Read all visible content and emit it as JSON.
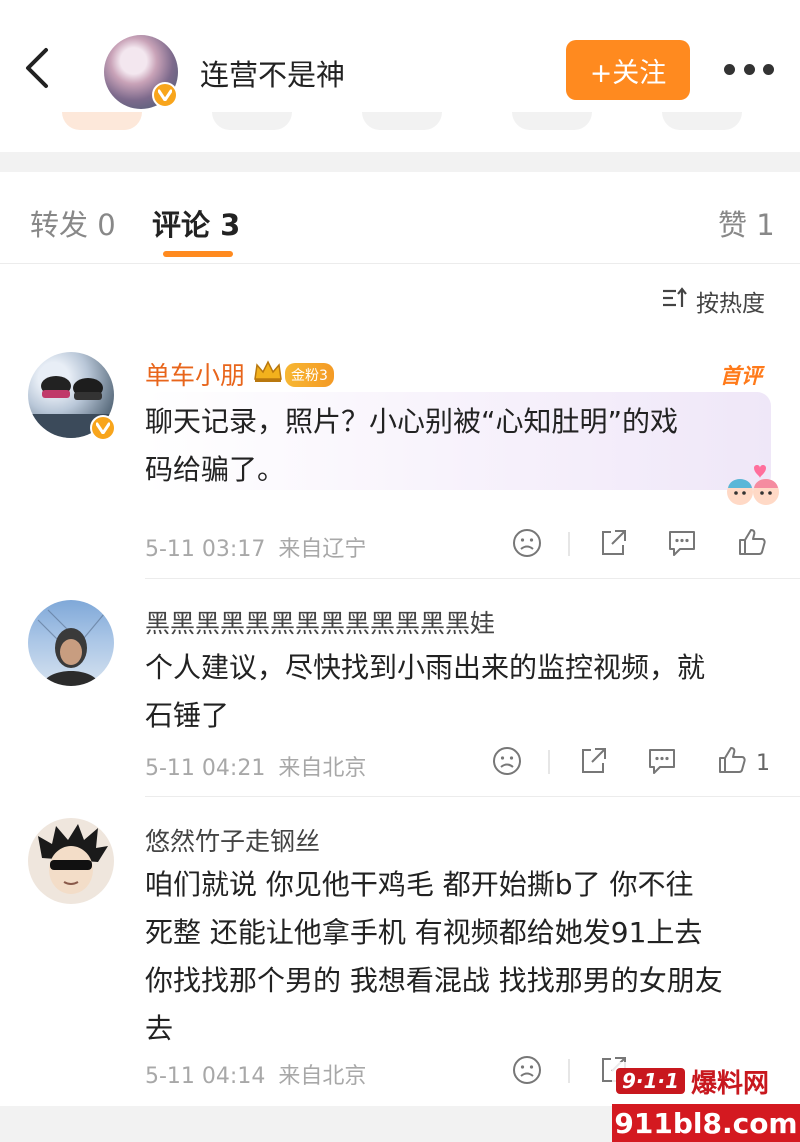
{
  "header": {
    "title": "连营不是神",
    "follow_label": "+关注"
  },
  "tabs": [
    {
      "label": "转发 0"
    },
    {
      "label": "评论 3"
    },
    {
      "label": "赞 1"
    }
  ],
  "sort_label": "按热度",
  "comments": [
    {
      "username": "单车小朋",
      "fans_badge": "金粉3",
      "top_badge": "首评",
      "text_line1": "聊天记录，照片？小心别被“心知肚明”的戏",
      "text_line2": "码给骗了。",
      "timestamp": "5-11 03:17",
      "location": "来自辽宁",
      "like_count": ""
    },
    {
      "username": "黑黑黑黑黑黑黑黑黑黑黑黑黑娃",
      "text_line1": "个人建议，尽快找到小雨出来的监控视频，就",
      "text_line2": "石锤了",
      "timestamp": "5-11 04:21",
      "location": "来自北京",
      "like_count": "1"
    },
    {
      "username": "悠然竹子走钢丝",
      "text_line1": "咱们就说 你见他干鸡毛 都开始撕b了 你不往",
      "text_line2": "死整 还能让他拿手机 有视频都给她发91上去",
      "text_line3": "你找找那个男的 我想看混战 找找那男的女朋友",
      "text_line4": "去",
      "timestamp": "5-11 04:14",
      "location": "来自北京",
      "like_count": ""
    }
  ],
  "watermark": {
    "logo": "9·1·1",
    "label": "爆料网",
    "url": "911bl8.com"
  },
  "colors": {
    "accent": "#ff8a1f",
    "vip_name": "#e8651b",
    "meta": "#a8a8a8",
    "verified": "#f8a51c"
  },
  "icons": [
    "back-arrow-icon",
    "verified-icon",
    "more-icon",
    "sort-icon",
    "dislike-icon",
    "share-icon",
    "comment-icon",
    "like-icon",
    "crown-icon"
  ]
}
